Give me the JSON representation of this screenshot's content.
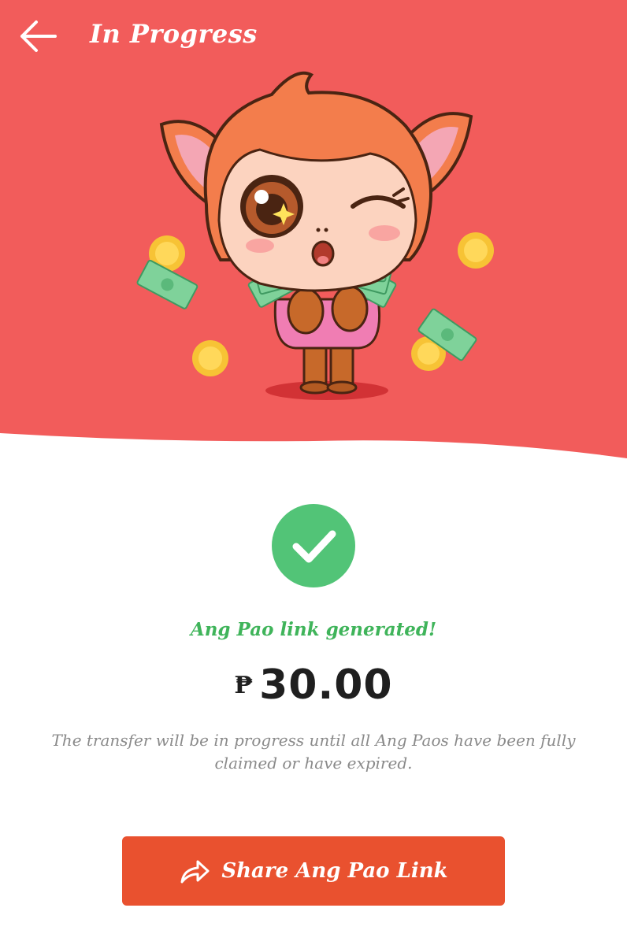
{
  "header": {
    "title": "In Progress",
    "back_icon": "arrow-left-icon"
  },
  "colors": {
    "hero_background": "#f25c5b",
    "accent_green": "#3fb45a",
    "check_circle": "#52c477",
    "button_background": "#e9512f",
    "note_text": "#8a8a8a"
  },
  "status": {
    "icon": "check-circle-icon",
    "message": "Ang Pao link generated!"
  },
  "amount": {
    "currency": "₱",
    "value": "30.00"
  },
  "note": "The transfer will be in progress until all Ang Paos have been fully claimed or have expired.",
  "share_button": {
    "icon": "share-arrow-icon",
    "label": "Share Ang Pao Link"
  }
}
